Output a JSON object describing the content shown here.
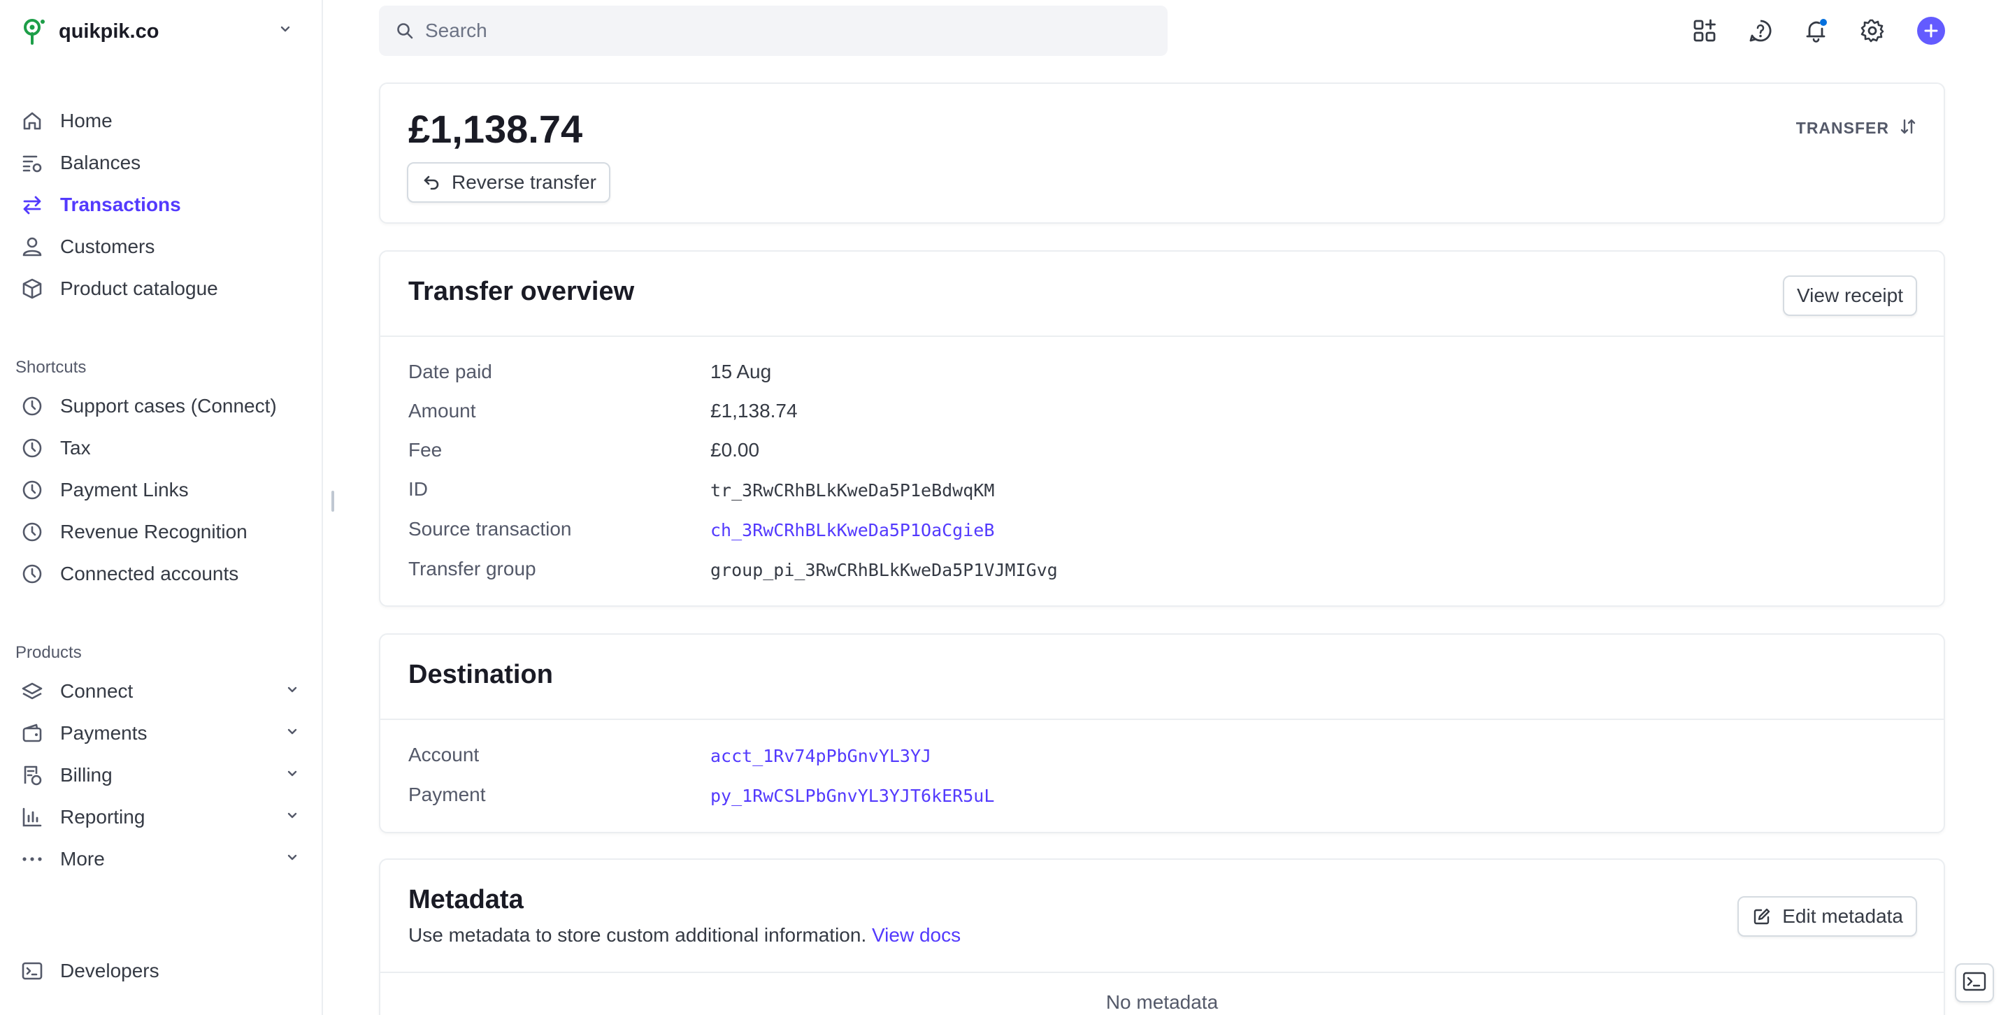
{
  "brand": {
    "name": "quikpik.co",
    "logo_icon": "pin-logo-icon",
    "accent": "#1d9e48"
  },
  "search": {
    "placeholder": "Search"
  },
  "topbar": {
    "icons": [
      "apps-icon",
      "help-icon",
      "bell-icon",
      "settings-icon",
      "plus-icon"
    ],
    "notification_dot_color": "#0570de"
  },
  "nav": {
    "main": [
      {
        "label": "Home",
        "icon": "home-icon"
      },
      {
        "label": "Balances",
        "icon": "balances-icon"
      },
      {
        "label": "Transactions",
        "icon": "transactions-icon",
        "active": true
      },
      {
        "label": "Customers",
        "icon": "person-icon"
      },
      {
        "label": "Product catalogue",
        "icon": "box-icon"
      }
    ],
    "shortcuts_title": "Shortcuts",
    "shortcuts": [
      {
        "label": "Support cases (Connect)",
        "icon": "clock-icon"
      },
      {
        "label": "Tax",
        "icon": "clock-icon"
      },
      {
        "label": "Payment Links",
        "icon": "clock-icon"
      },
      {
        "label": "Revenue Recognition",
        "icon": "clock-icon"
      },
      {
        "label": "Connected accounts",
        "icon": "clock-icon"
      }
    ],
    "products_title": "Products",
    "products": [
      {
        "label": "Connect",
        "icon": "layers-icon"
      },
      {
        "label": "Payments",
        "icon": "wallet-icon"
      },
      {
        "label": "Billing",
        "icon": "billing-icon"
      },
      {
        "label": "Reporting",
        "icon": "chart-icon"
      },
      {
        "label": "More",
        "icon": "more-icon"
      }
    ],
    "developers": {
      "label": "Developers",
      "icon": "terminal-icon"
    }
  },
  "header": {
    "amount": "£1,138.74",
    "reverse_label": "Reverse transfer",
    "type_label": "TRANSFER"
  },
  "overview": {
    "title": "Transfer overview",
    "view_receipt": "View receipt",
    "rows": [
      {
        "label": "Date paid",
        "value": "15 Aug"
      },
      {
        "label": "Amount",
        "value": "£1,138.74"
      },
      {
        "label": "Fee",
        "value": "£0.00"
      },
      {
        "label": "ID",
        "value": "tr_3RwCRhBLkKweDa5P1eBdwqKM"
      },
      {
        "label": "Source transaction",
        "value": "ch_3RwCRhBLkKweDa5P1OaCgieB"
      },
      {
        "label": "Transfer group",
        "value": "group_pi_3RwCRhBLkKweDa5P1VJMIGvg"
      }
    ]
  },
  "destination": {
    "title": "Destination",
    "rows": [
      {
        "label": "Account",
        "value": "acct_1Rv74pPbGnvYL3YJ"
      },
      {
        "label": "Payment",
        "value": "py_1RwCSLPbGnvYL3YJT6kER5uL"
      }
    ]
  },
  "metadata": {
    "title": "Metadata",
    "description": "Use metadata to store custom additional information.",
    "docs_link": "View docs",
    "edit_label": "Edit metadata",
    "empty": "No metadata"
  },
  "colors": {
    "accent": "#533afd",
    "text": "#1a1b25",
    "muted": "#545969"
  }
}
